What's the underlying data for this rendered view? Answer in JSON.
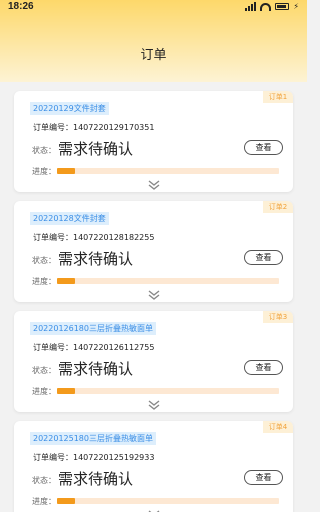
{
  "status_bar": {
    "time": "18:26"
  },
  "header": {
    "title": "订单"
  },
  "orders": [
    {
      "tag": "订单1",
      "name": "20220129文件封套",
      "number_label": "订单编号：",
      "number": "1407220129170351",
      "status_label": "状态：",
      "status": "需求待确认",
      "button": "查看",
      "progress_label": "进度：",
      "progress": 0.08
    },
    {
      "tag": "订单2",
      "name": "20220128文件封套",
      "number_label": "订单编号：",
      "number": "1407220128182255",
      "status_label": "状态：",
      "status": "需求待确认",
      "button": "查看",
      "progress_label": "进度：",
      "progress": 0.08
    },
    {
      "tag": "订单3",
      "name": "20220126180三层折叠热敏面单",
      "number_label": "订单编号：",
      "number": "1407220126112755",
      "status_label": "状态：",
      "status": "需求待确认",
      "button": "查看",
      "progress_label": "进度：",
      "progress": 0.08
    },
    {
      "tag": "订单4",
      "name": "20220125180三层折叠热敏面单",
      "number_label": "订单编号：",
      "number": "1407220125192933",
      "status_label": "状态：",
      "status": "需求待确认",
      "button": "查看",
      "progress_label": "进度：",
      "progress": 0.08
    }
  ],
  "colors": {
    "accent": "#f39a1c",
    "header_top": "#fdd86a",
    "tag_text": "#f1a23a",
    "name_text": "#3a8ee6"
  },
  "icons": {
    "expand": "chevron-double-down-icon"
  }
}
